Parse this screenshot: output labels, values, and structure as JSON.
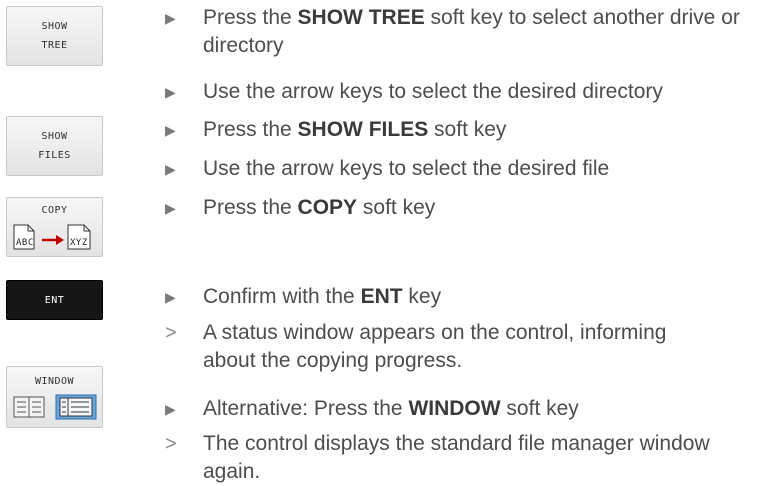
{
  "softkeys": {
    "show_tree": [
      "SHOW",
      "TREE"
    ],
    "show_files": [
      "SHOW",
      "FILES"
    ],
    "copy": {
      "label": "COPY",
      "from": "ABC",
      "to": "XYZ"
    },
    "ent": "ENT",
    "window": {
      "label": "WINDOW"
    }
  },
  "markers": {
    "action": "▶",
    "result": ">"
  },
  "steps": [
    {
      "before": "Press the ",
      "bold": "SHOW TREE",
      "after": " soft key to select another drive or directory"
    },
    {
      "before": "Use the arrow keys to select the desired directory",
      "bold": "",
      "after": ""
    },
    {
      "before": "Press the ",
      "bold": "SHOW FILES",
      "after": " soft key"
    },
    {
      "before": "Use the arrow keys to select the desired file",
      "bold": "",
      "after": ""
    },
    {
      "before": "Press the ",
      "bold": "COPY",
      "after": " soft key"
    },
    {
      "before": "Confirm with the ",
      "bold": "ENT",
      "after": " key"
    },
    {
      "before": "A status window appears on the control, informing about the copying progress.",
      "bold": "",
      "after": ""
    },
    {
      "before": "Alternative: Press the ",
      "bold": "WINDOW",
      "after": " soft key"
    },
    {
      "before": "The control displays the standard file manager window again.",
      "bold": "",
      "after": ""
    }
  ]
}
